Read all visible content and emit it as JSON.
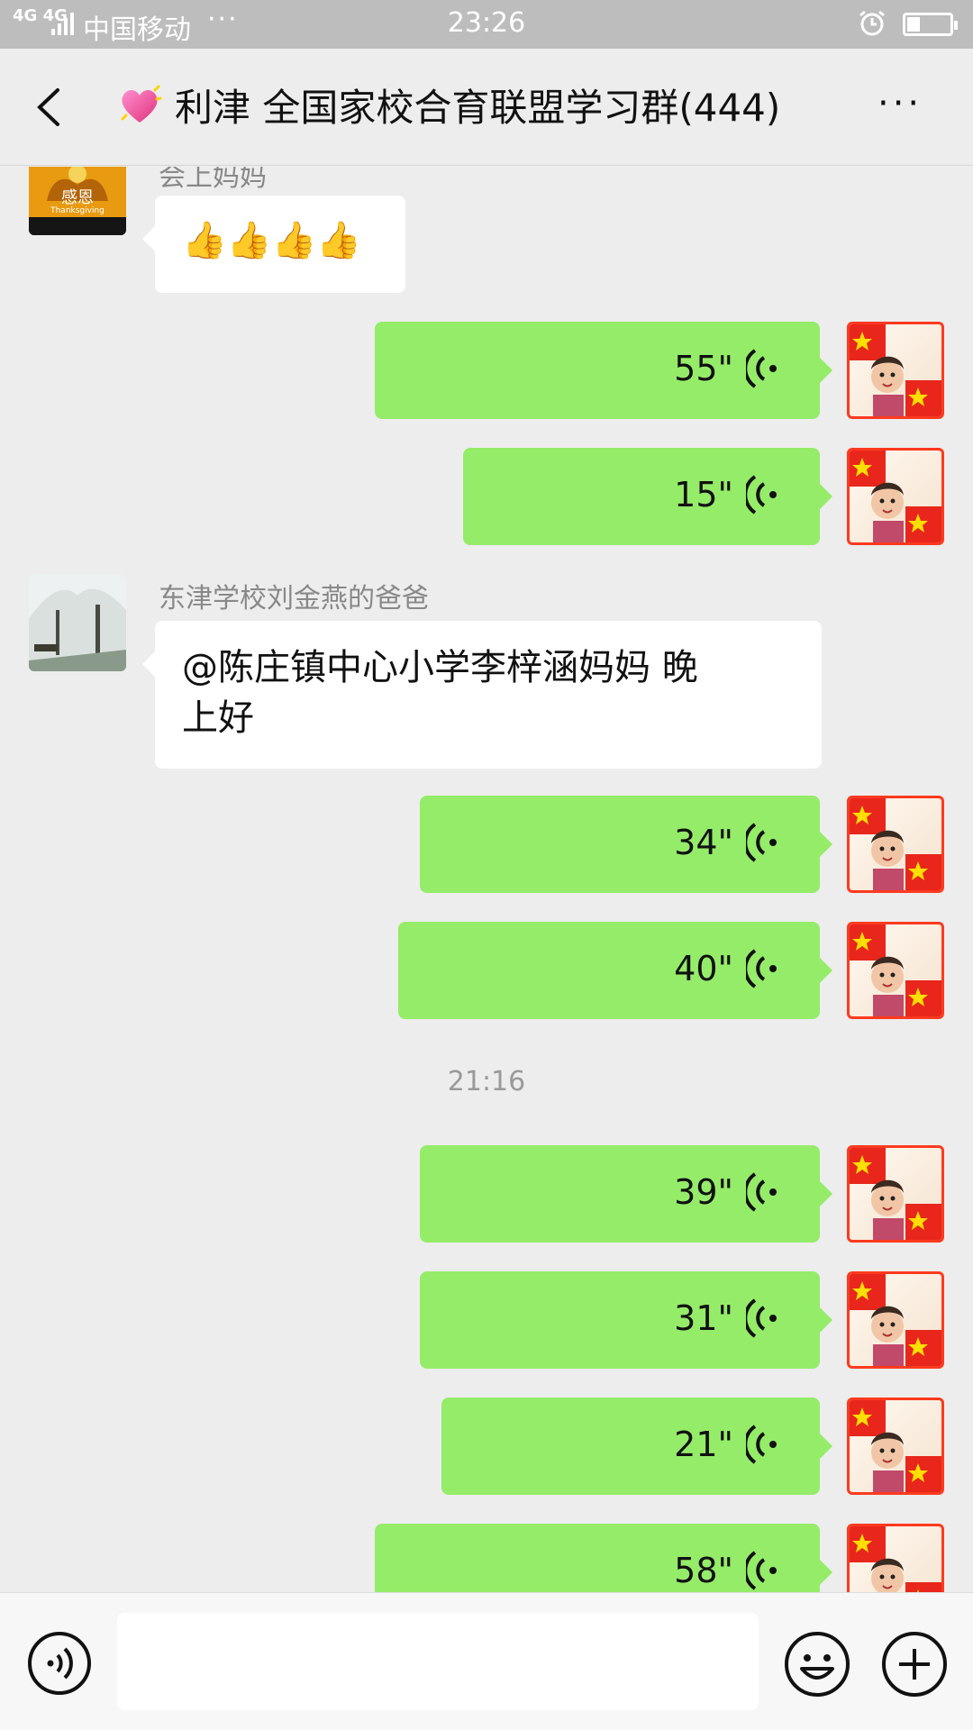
{
  "status_bar": {
    "network": "4G 4G",
    "carrier": "中国移动",
    "more": "···",
    "time": "23:26",
    "battery_level": 0.3
  },
  "header": {
    "title": "利津 全国家校合育联盟学习群(444)",
    "more_label": "···"
  },
  "messages": [
    {
      "sender": "会上妈妈",
      "type": "emoji",
      "text": "👍👍👍👍"
    },
    {
      "sender": "self",
      "type": "voice",
      "duration": "55\""
    },
    {
      "sender": "self",
      "type": "voice",
      "duration": "15\""
    },
    {
      "sender": "东津学校刘金燕的爸爸",
      "type": "text",
      "text_line1": "@陈庄镇中心小学李梓涵妈妈  晚",
      "text_line2": "上好"
    },
    {
      "sender": "self",
      "type": "voice",
      "duration": "34\""
    },
    {
      "sender": "self",
      "type": "voice",
      "duration": "40\""
    },
    {
      "type": "timestamp",
      "text": "21:16"
    },
    {
      "sender": "self",
      "type": "voice",
      "duration": "39\""
    },
    {
      "sender": "self",
      "type": "voice",
      "duration": "31\""
    },
    {
      "sender": "self",
      "type": "voice",
      "duration": "21\""
    },
    {
      "sender": "self",
      "type": "voice",
      "duration": "58\""
    }
  ],
  "avatar_text": {
    "thanks_cn": "感恩",
    "thanks_en": "Thanksgiving"
  },
  "colors": {
    "bubble_self": "#95ec69",
    "bubble_other": "#ffffff",
    "background": "#ededed",
    "avatar_border_self": "#ff3a1f"
  },
  "icons": [
    "back-arrow-icon",
    "heart-emoji-icon",
    "more-icon",
    "voice-wave-icon",
    "voice-input-icon",
    "emoji-icon",
    "plus-icon",
    "alarm-icon",
    "battery-icon"
  ]
}
